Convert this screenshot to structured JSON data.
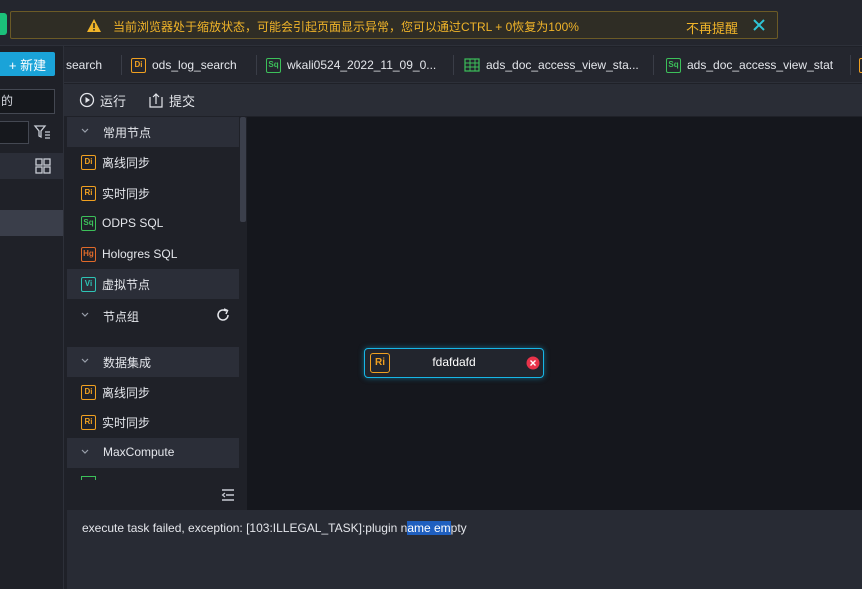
{
  "notice": {
    "message": "当前浏览器处于缩放状态，可能会引起页面显示异常，您可以通过CTRL + 0恢复为100%",
    "dismiss_label": "不再提醒",
    "warn_icon": "warning-icon",
    "close_icon": "close-icon",
    "color": "#f0b429"
  },
  "left_panel": {
    "new_label": "+ 新建",
    "input_value": "的"
  },
  "tabs": [
    {
      "label": "search",
      "badge": ""
    },
    {
      "label": "ods_log_search",
      "badge": "Di"
    },
    {
      "label": "wkali0524_2022_11_09_0...",
      "badge": "Sq"
    },
    {
      "label": "ads_doc_access_view_sta...",
      "badge": "table"
    },
    {
      "label": "ads_doc_access_view_stat",
      "badge": "Sq"
    }
  ],
  "toolbar": {
    "run_label": "运行",
    "submit_label": "提交"
  },
  "palette": {
    "group_common": "常用节点",
    "common_items": [
      {
        "badge": "Di",
        "label": "离线同步"
      },
      {
        "badge": "Ri",
        "label": "实时同步"
      },
      {
        "badge": "Sq",
        "label": "ODPS SQL"
      },
      {
        "badge": "Hg",
        "label": "Hologres SQL"
      },
      {
        "badge": "Vi",
        "label": "虚拟节点"
      }
    ],
    "group_nodes": "节点组",
    "group_integration": "数据集成",
    "integration_items": [
      {
        "badge": "Di",
        "label": "离线同步"
      },
      {
        "badge": "Ri",
        "label": "实时同步"
      }
    ],
    "group_maxcompute": "MaxCompute"
  },
  "canvas": {
    "node": {
      "badge": "Ri",
      "label": "fdafdafd",
      "status": "error"
    }
  },
  "log": {
    "text_before": "execute task failed, exception: [103:ILLEGAL_TASK]:plugin n",
    "text_highlight": "ame em",
    "text_after": "pty"
  }
}
